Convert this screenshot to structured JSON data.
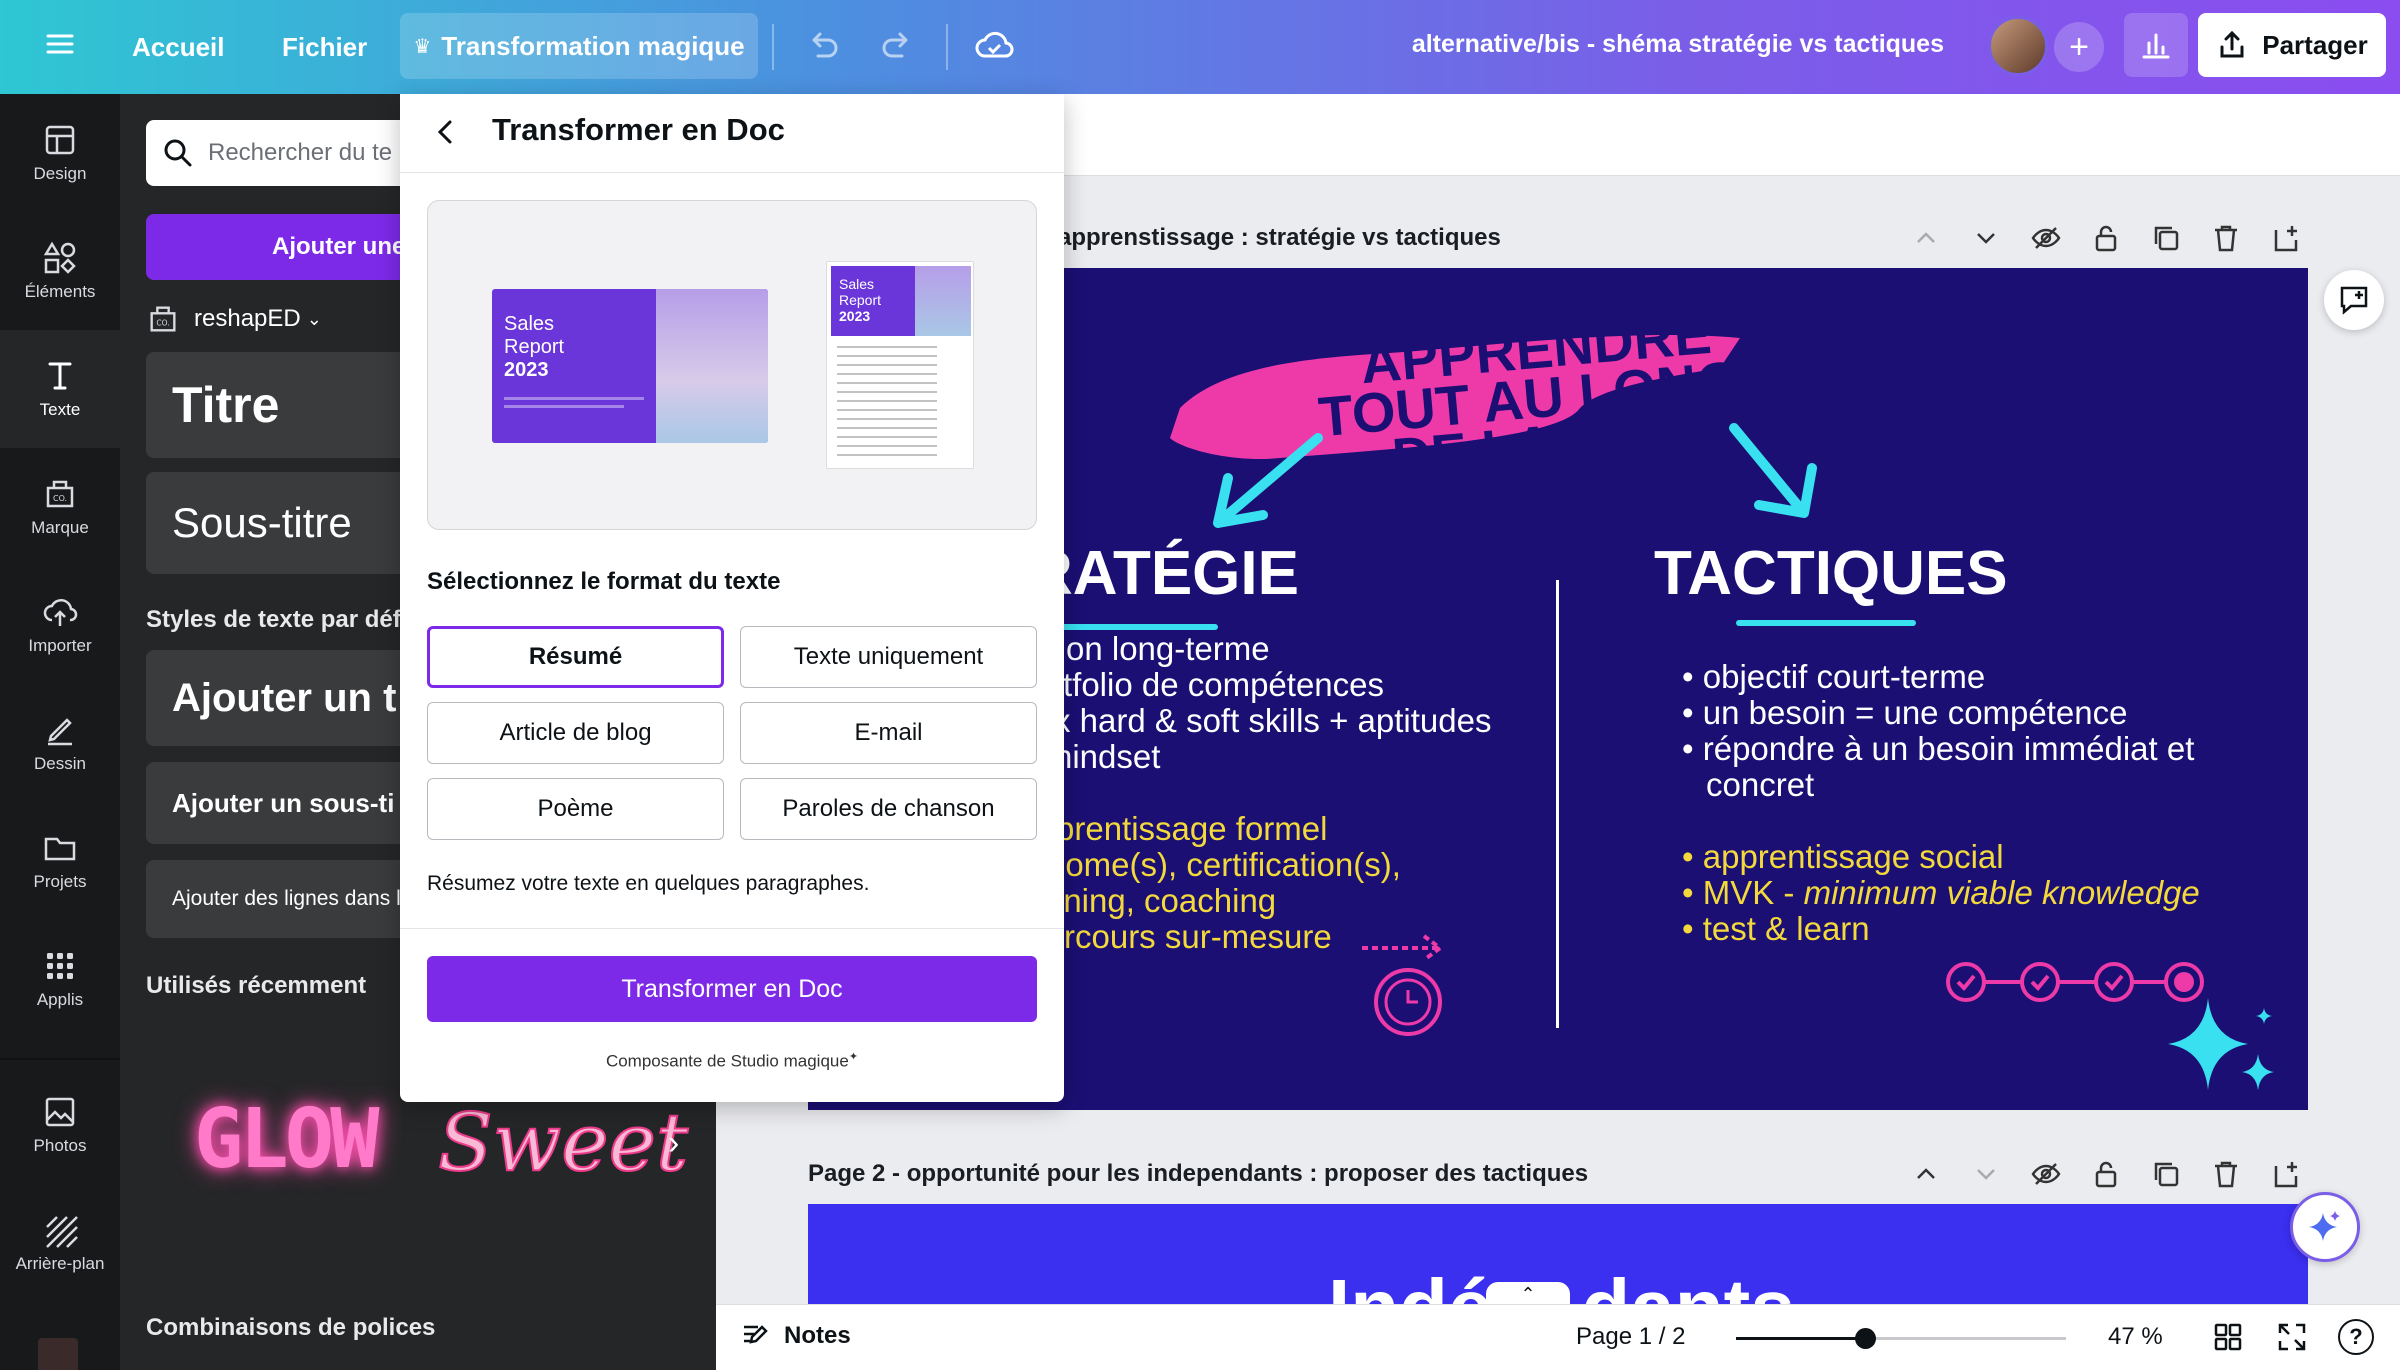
{
  "topbar": {
    "home": "Accueil",
    "file": "Fichier",
    "magic": "Transformation magique",
    "doc_title": "alternative/bis - shéma stratégie vs tactiques",
    "share": "Partager"
  },
  "rail": [
    {
      "label": "Design",
      "icon": "layout-icon"
    },
    {
      "label": "Éléments",
      "icon": "shapes-icon"
    },
    {
      "label": "Texte",
      "icon": "text-icon"
    },
    {
      "label": "Marque",
      "icon": "brand-icon"
    },
    {
      "label": "Importer",
      "icon": "cloud-upload-icon"
    },
    {
      "label": "Dessin",
      "icon": "pen-icon"
    },
    {
      "label": "Projets",
      "icon": "folder-icon"
    },
    {
      "label": "Applis",
      "icon": "apps-grid-icon"
    },
    {
      "label": "Photos",
      "icon": "photo-icon"
    },
    {
      "label": "Arrière-plan",
      "icon": "hatch-icon"
    }
  ],
  "sidepanel": {
    "search_placeholder": "Rechercher du te",
    "add_text": "Ajouter une",
    "brand_kit": "reshapED",
    "title": "Titre",
    "subtitle": "Sous-titre",
    "default_styles": "Styles de texte par déf",
    "add_heading": "Ajouter un t",
    "add_subheading": "Ajouter un sous-ti",
    "add_body": "Ajouter des lignes dans l",
    "recent": "Utilisés récemment",
    "glow": "GLOW",
    "sweet": "Sweet",
    "font_combos": "Combinaisons de polices"
  },
  "modal": {
    "title": "Transformer en Doc",
    "preview_landscape": {
      "line1": "Sales",
      "line2": "Report",
      "line3": "2023"
    },
    "preview_portrait": {
      "line1": "Sales",
      "line2": "Report",
      "line3": "2023"
    },
    "select_label": "Sélectionnez le format du texte",
    "formats": [
      "Résumé",
      "Texte uniquement",
      "Article de blog",
      "E-mail",
      "Poème",
      "Paroles de chanson"
    ],
    "selected_format": "Résumé",
    "description": "Résumez votre texte en quelques paragraphes.",
    "button": "Transformer en Doc",
    "footer": "Composante de Studio magique"
  },
  "page1": {
    "title": "apprenstissage : stratégie vs tactiques",
    "banner": [
      "APPRENDRE",
      "TOUT AU LONG",
      "DE LA VIE"
    ],
    "left_heading": "RATÉGIE",
    "left_white": [
      "on long-terme",
      "rtfolio de compétences",
      "x hard & soft skills + aptitudes",
      "nindset"
    ],
    "left_yellow": [
      "prentissage formel",
      "lome(s), certification(s),",
      "ining, coaching",
      "rcours sur-mesure"
    ],
    "right_heading": "TACTIQUES",
    "right_white": [
      "objectif court-terme",
      "un besoin = une compétence",
      "répondre à un besoin immédiat et",
      "concret"
    ],
    "right_yellow": [
      "apprentissage social",
      "MVK - ",
      "minimum viable knowledge",
      "test & learn"
    ]
  },
  "page2": {
    "title": "Page 2 - opportunité pour les independants : proposer des tactiques",
    "partial_text": "Indé    dants"
  },
  "bottombar": {
    "notes": "Notes",
    "page": "Page 1 / 2",
    "zoom": "47 %",
    "zoom_level": 0.39
  },
  "colors": {
    "accent": "#7d2ae8",
    "slide_bg": "#1b0f74",
    "pink": "#ee3aa8",
    "cyan": "#38e0f0",
    "yellow": "#f3d93b"
  }
}
